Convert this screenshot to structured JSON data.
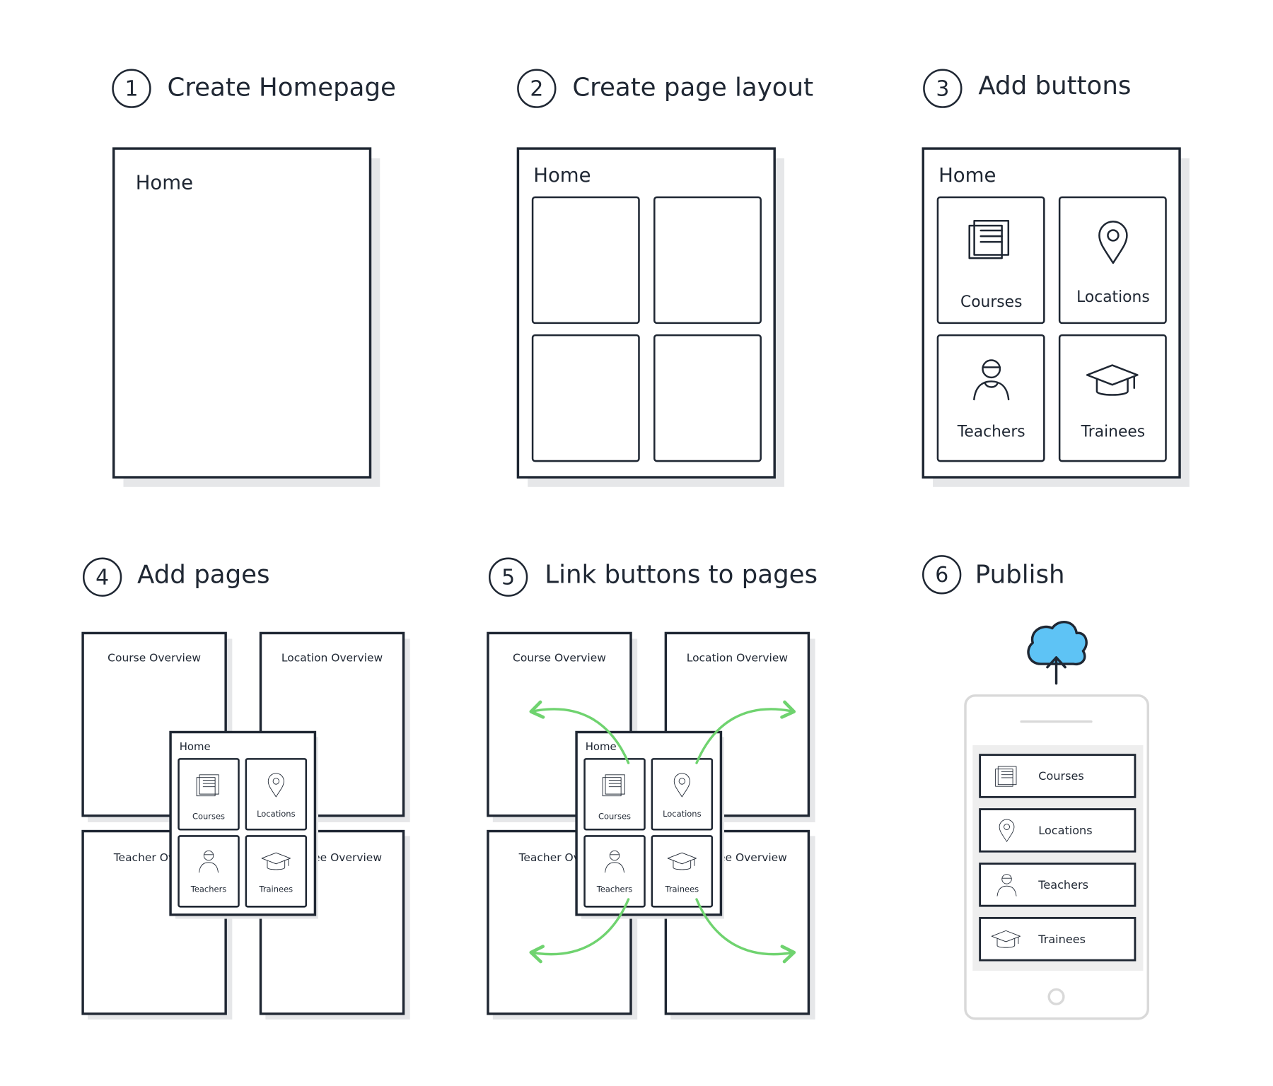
{
  "steps": [
    {
      "number": "1",
      "title": "Create Homepage"
    },
    {
      "number": "2",
      "title": "Create page layout"
    },
    {
      "number": "3",
      "title": "Add buttons"
    },
    {
      "number": "4",
      "title": "Add pages"
    },
    {
      "number": "5",
      "title": "Link buttons to pages"
    },
    {
      "number": "6",
      "title": "Publish"
    }
  ],
  "home_label": "Home",
  "buttons": [
    {
      "label": "Courses",
      "icon": "courses-icon"
    },
    {
      "label": "Locations",
      "icon": "location-pin-icon"
    },
    {
      "label": "Teachers",
      "icon": "teacher-icon"
    },
    {
      "label": "Trainees",
      "icon": "graduation-cap-icon"
    }
  ],
  "overview_pages": {
    "course": "Course Overview",
    "location": "Location Overview",
    "teacher_partial": "Teacher Ove",
    "trainee_partial": "ee Overview"
  },
  "colors": {
    "ink": "#1f2733",
    "link_arrow": "#6fd36f",
    "cloud": "#5ec3f5",
    "phone_frame": "#d9d9d9"
  },
  "publish_icon": "cloud-upload-icon"
}
